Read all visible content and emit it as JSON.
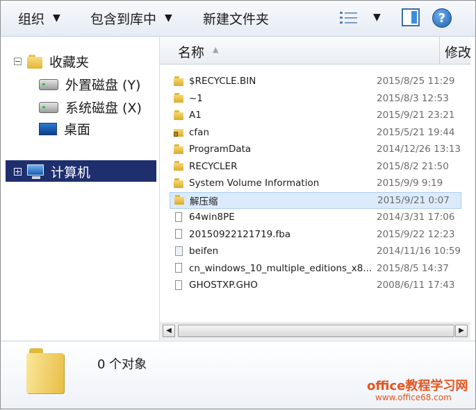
{
  "toolbar": {
    "organize": "组织",
    "include_in_library": "包含到库中",
    "new_folder": "新建文件夹",
    "dropdown_arrow": "▼",
    "help": "?"
  },
  "nav": {
    "favorites": "收藏夹",
    "external_drive": "外置磁盘 (Y)",
    "system_drive": "系统磁盘 (X)",
    "desktop": "桌面",
    "computer": "计算机",
    "collapse_symbol": "−",
    "expand_symbol": "+"
  },
  "columns": {
    "name": "名称",
    "modified": "修改"
  },
  "files": [
    {
      "name": "$RECYCLE.BIN",
      "date": "2015/8/25 11:29",
      "icon": "folder-icon"
    },
    {
      "name": "~1",
      "date": "2015/8/3 12:53",
      "icon": "folder-icon"
    },
    {
      "name": "A1",
      "date": "2015/9/21 23:21",
      "icon": "folder-icon"
    },
    {
      "name": "cfan",
      "date": "2015/5/21 19:44",
      "icon": "locked-folder-icon"
    },
    {
      "name": "ProgramData",
      "date": "2014/12/26 13:13",
      "icon": "folder-icon"
    },
    {
      "name": "RECYCLER",
      "date": "2015/8/2 21:50",
      "icon": "folder-icon"
    },
    {
      "name": "System Volume Information",
      "date": "2015/9/9 9:19",
      "icon": "folder-icon"
    },
    {
      "name": "解压缩",
      "date": "2015/9/21 0:07",
      "icon": "folder-icon",
      "selected": true
    },
    {
      "name": "64win8PE",
      "date": "2014/3/31 17:06",
      "icon": "file-icon"
    },
    {
      "name": "20150922121719.fba",
      "date": "2015/9/22 12:23",
      "icon": "file-icon"
    },
    {
      "name": "beifen",
      "date": "2014/11/16 10:59",
      "icon": "image-file-icon"
    },
    {
      "name": "cn_windows_10_multiple_editions_x8...",
      "date": "2015/8/5 14:37",
      "icon": "file-icon"
    },
    {
      "name": "GHOSTXP.GHO",
      "date": "2008/6/11 17:43",
      "icon": "file-icon"
    }
  ],
  "details": {
    "object_count": "0 个对象"
  },
  "watermark": {
    "line1": "office教程学习网",
    "line2": "www.office68.com"
  }
}
